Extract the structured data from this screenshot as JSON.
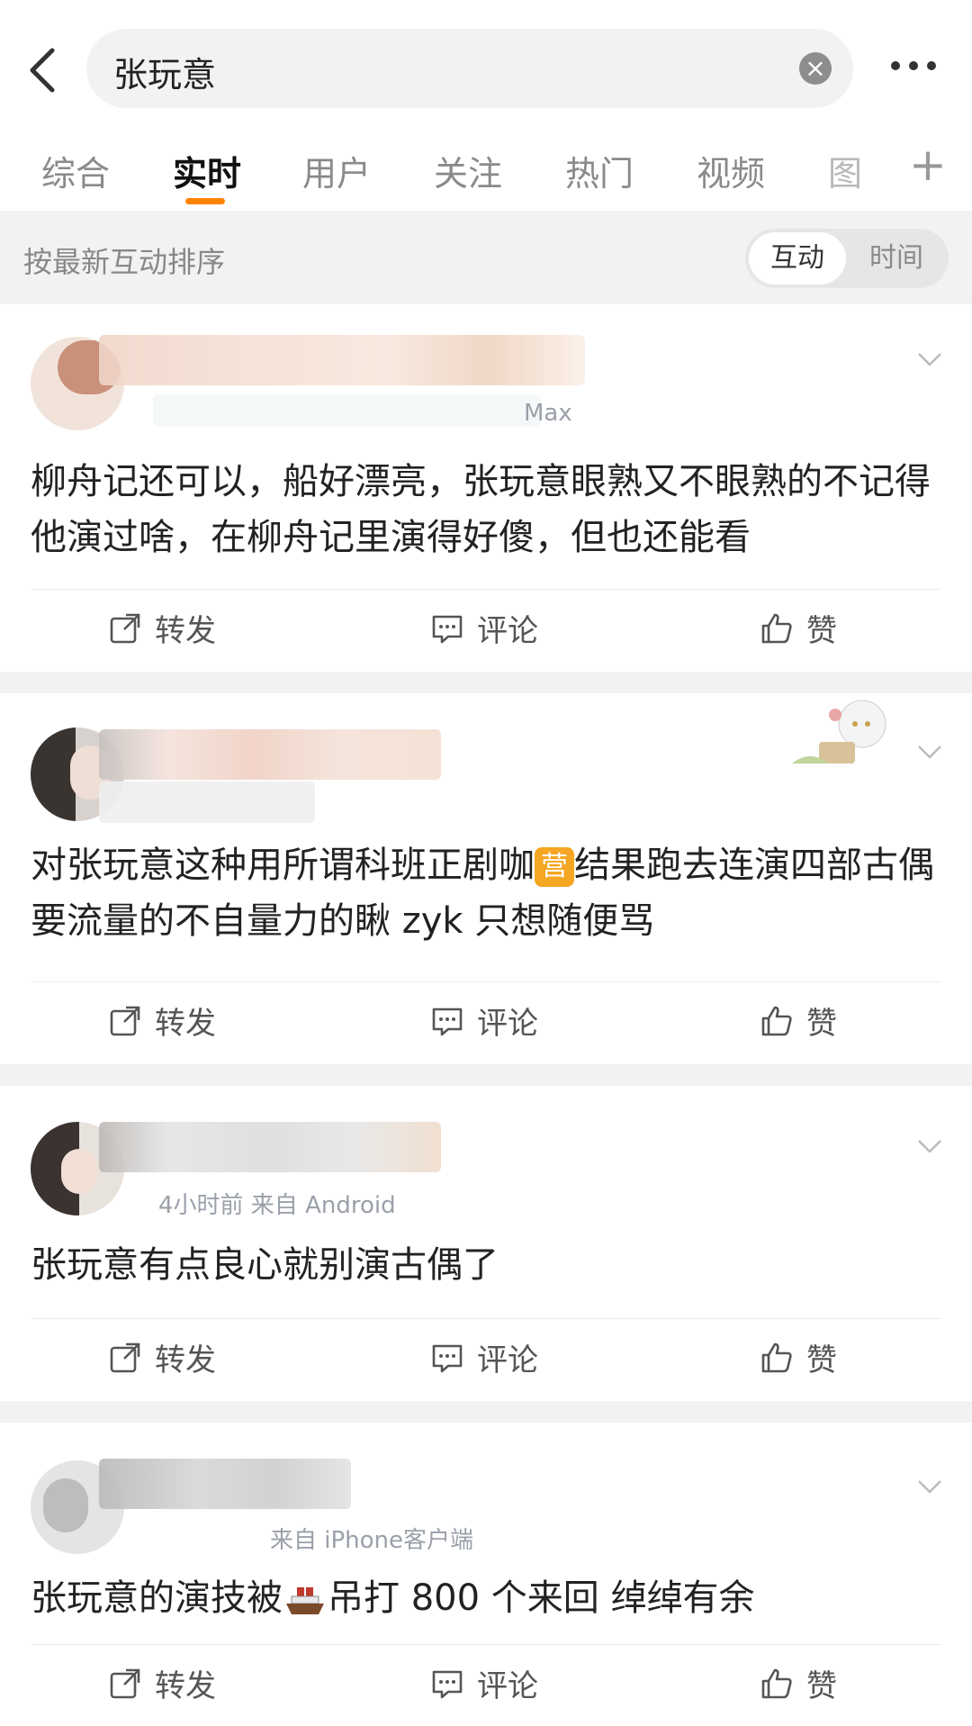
{
  "search": {
    "query": "张玩意"
  },
  "tabs": [
    "综合",
    "实时",
    "用户",
    "关注",
    "热门",
    "视频",
    "图"
  ],
  "sort": {
    "label": "按最新互动排序",
    "options": [
      "互动",
      "时间"
    ]
  },
  "actions": {
    "repost": "转发",
    "comment": "评论",
    "like": "赞"
  },
  "posts": [
    {
      "meta": "Max",
      "text": "柳舟记还可以，船好漂亮，张玩意眼熟又不眼熟的不记得他演过啥，在柳舟记里演得好傻，但也还能看"
    },
    {
      "meta": "",
      "text_a": "对张玩意这种用所谓科班正剧咖",
      "badge": "营",
      "text_b": "结果跑去连演四部古偶要流量的不自量力的瞅 zyk 只想随便骂"
    },
    {
      "meta": "4小时前  来自 Android",
      "text": "张玩意有点良心就别演古偶了"
    },
    {
      "meta": "来自 iPhone客户端",
      "text_a": "张玩意的演技被",
      "text_b": "吊打 800 个来回 绰绰有余"
    }
  ]
}
